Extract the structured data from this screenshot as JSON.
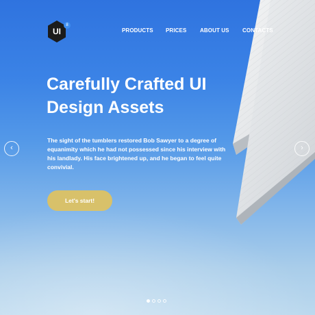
{
  "logo": {
    "text": "UI",
    "badge": "8"
  },
  "nav": {
    "items": [
      {
        "label": "PRODUCTS"
      },
      {
        "label": "PRICES"
      },
      {
        "label": "ABOUT US"
      },
      {
        "label": "CONTACTS"
      }
    ]
  },
  "hero": {
    "headline": "Carefully Crafted UI Design Assets",
    "description": "The sight of the tumblers restored Bob Sawyer to a degree of equanimity which he had not possessed since his interview with his landlady. His face brightened up, and he began to feel quite convivial.",
    "cta_label": "Let's start!"
  },
  "carousel": {
    "prev_icon": "chevron-left-icon",
    "next_icon": "chevron-right-icon",
    "prev_glyph": "‹",
    "next_glyph": "›",
    "slide_count": 4,
    "active_slide": 1
  },
  "colors": {
    "sky_top": "#2f73df",
    "sky_bottom": "#bcd9ee",
    "cta": "#d8c16a",
    "logo_bg": "#1b1b1b",
    "logo_badge": "#3d8ef2"
  }
}
